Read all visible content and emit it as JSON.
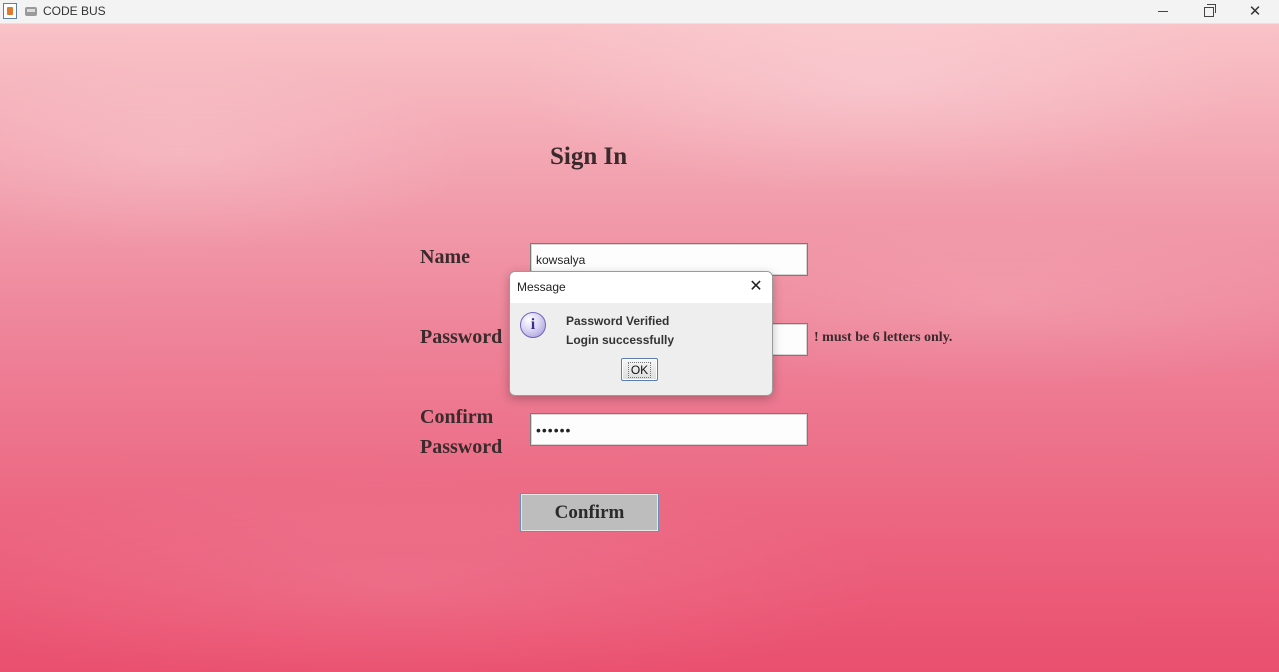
{
  "window": {
    "title": "CODE BUS",
    "controls": {
      "minimize": "—",
      "maximize": "❐",
      "close": "✕"
    }
  },
  "form": {
    "heading": "Sign In",
    "name_label": "Name",
    "name_value": "kowsalya",
    "password_label": "Password",
    "password_value": "",
    "password_hint": "! must be 6 letters only.",
    "confirm_label_line1": "Confirm",
    "confirm_label_line2": "Password",
    "confirm_value": "••••••",
    "confirm_button": "Confirm"
  },
  "dialog": {
    "title": "Message",
    "close": "✕",
    "icon": "info-icon",
    "message_line1": "Password Verified",
    "message_line2": "Login successfully",
    "ok_button": "OK"
  },
  "colors": {
    "background_top": "#f9c3c8",
    "background_bottom": "#ea4f6f",
    "label_text": "#3a2a2c",
    "button_face": "#bdbdbd",
    "focus_border": "#6d8fb5"
  }
}
